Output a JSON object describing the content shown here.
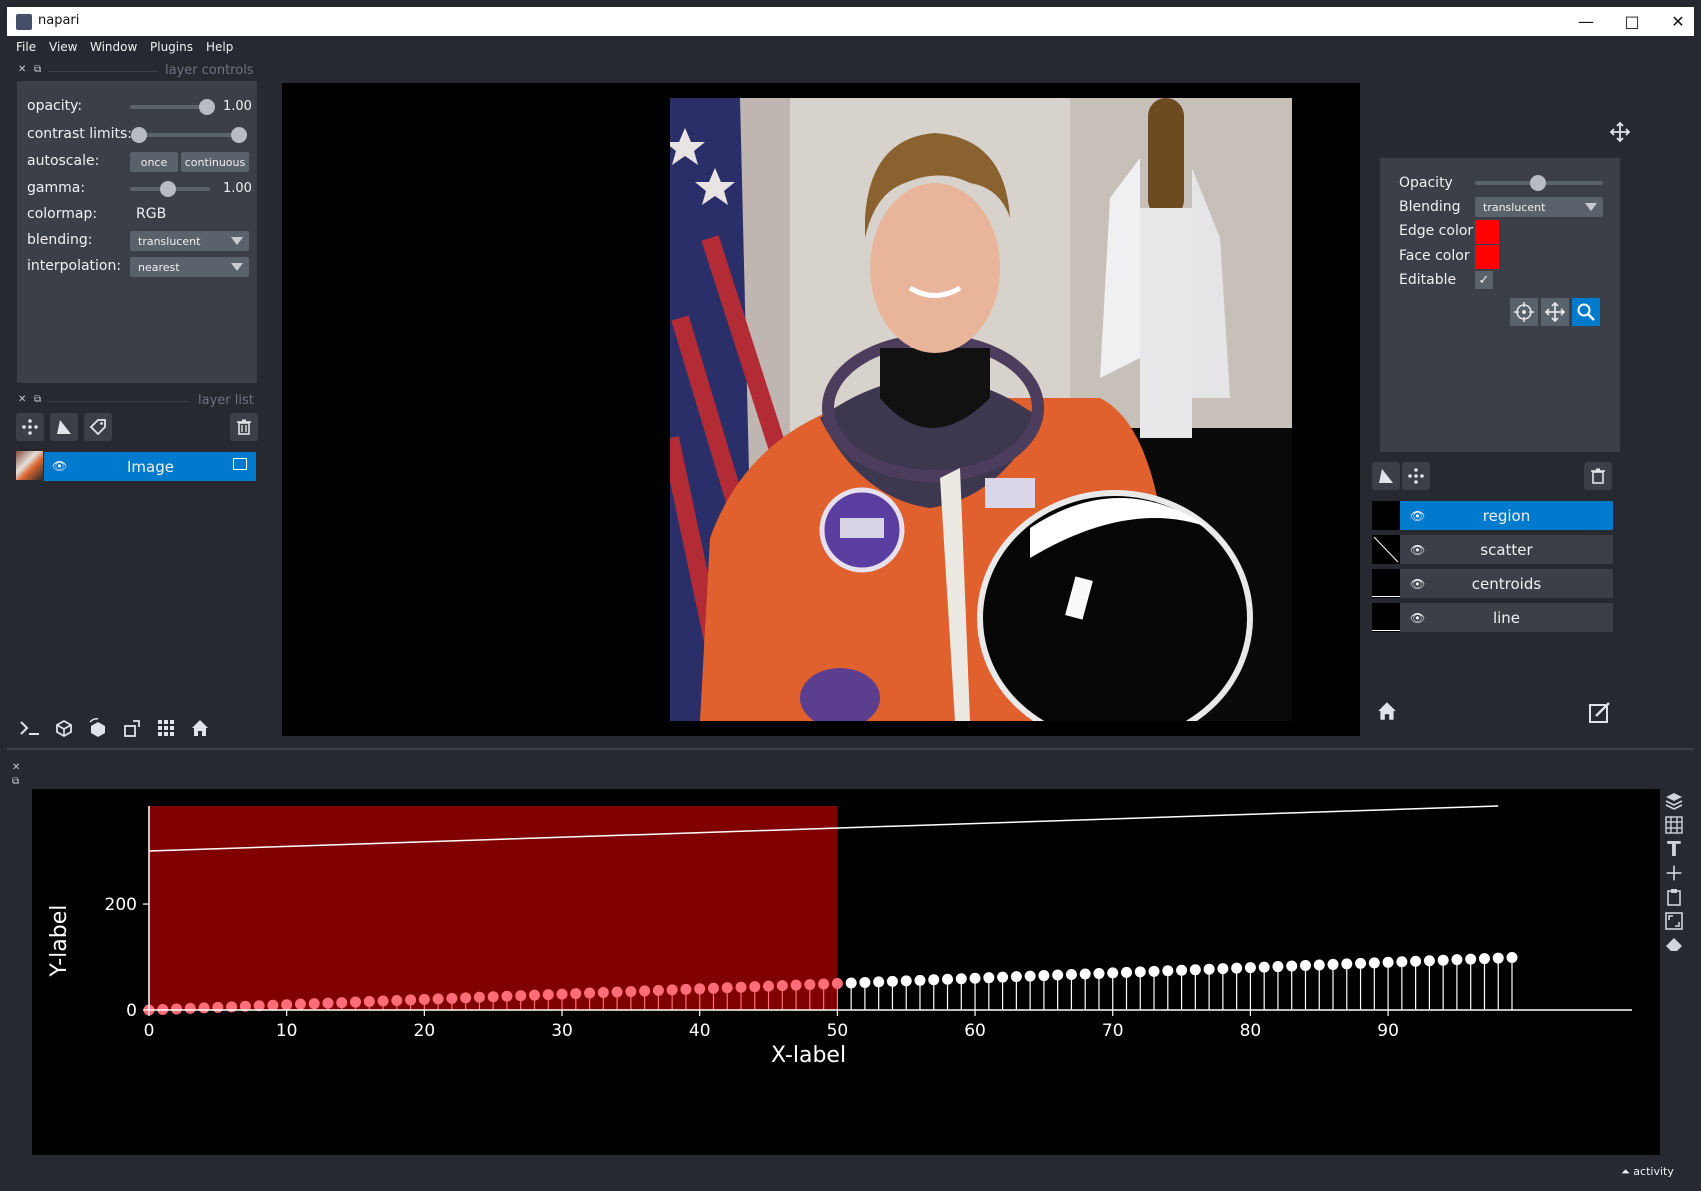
{
  "window": {
    "title": "napari"
  },
  "menu": [
    "File",
    "View",
    "Window",
    "Plugins",
    "Help"
  ],
  "layer_controls": {
    "caption": "layer controls",
    "opacity_label": "opacity:",
    "opacity_value": "1.00",
    "contrast_label": "contrast limits:",
    "autoscale_label": "autoscale:",
    "autoscale_once": "once",
    "autoscale_continuous": "continuous",
    "gamma_label": "gamma:",
    "gamma_value": "1.00",
    "colormap_label": "colormap:",
    "colormap_value": "RGB",
    "blending_label": "blending:",
    "blending_value": "translucent",
    "interpolation_label": "interpolation:",
    "interpolation_value": "nearest"
  },
  "layer_list": {
    "caption": "layer list",
    "layers": [
      {
        "name": "Image",
        "selected": true
      }
    ]
  },
  "right_panel": {
    "opacity_label": "Opacity",
    "blending_label": "Blending",
    "blending_value": "translucent",
    "edge_color_label": "Edge color",
    "face_color_label": "Face color",
    "editable_label": "Editable",
    "edge_color": "#ff0000",
    "face_color": "#ff0000",
    "layers": [
      {
        "name": "region",
        "selected": true
      },
      {
        "name": "scatter",
        "selected": false
      },
      {
        "name": "centroids",
        "selected": false
      },
      {
        "name": "line",
        "selected": false
      }
    ]
  },
  "status": {
    "activity_label": "activity"
  },
  "chart_data": {
    "type": "scatter",
    "xlabel": "X-label",
    "ylabel": "Y-label",
    "xlim": [
      0,
      99
    ],
    "ylim": [
      0,
      385
    ],
    "xticks": [
      0,
      10,
      20,
      30,
      40,
      50,
      60,
      70,
      80,
      90
    ],
    "yticks": [
      0,
      200
    ],
    "region": {
      "x0": 0,
      "x1": 50,
      "color": "#800000"
    },
    "line": {
      "x": [
        0,
        98
      ],
      "y": [
        300,
        385
      ],
      "color": "#ffffff"
    },
    "scatter": {
      "x_start": 0,
      "x_end": 99,
      "step": 1,
      "y_formula": "y = x",
      "stems": true,
      "color": "#ffffff",
      "highlight_color": "#ff6e78"
    }
  }
}
